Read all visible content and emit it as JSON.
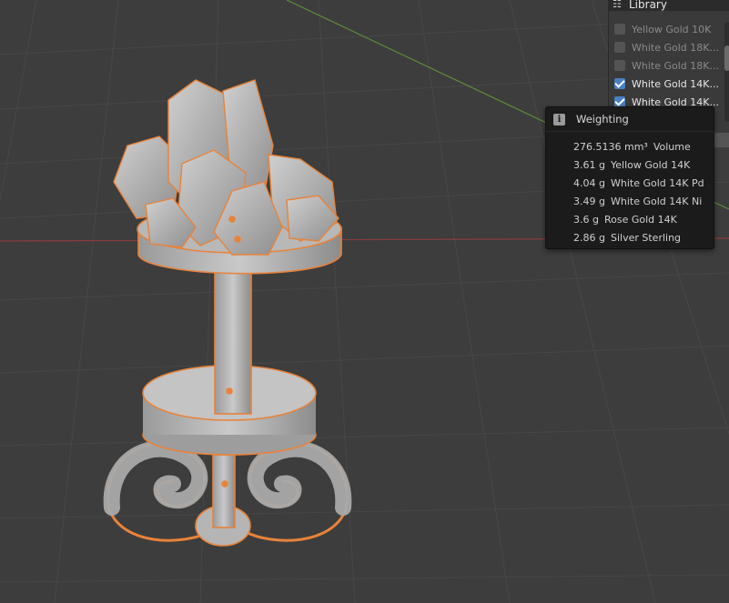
{
  "library": {
    "title": "Library",
    "items": [
      {
        "label": "Yellow Gold 10K",
        "checked": false
      },
      {
        "label": "White Gold 18K...",
        "checked": false
      },
      {
        "label": "White Gold 18K...",
        "checked": false
      },
      {
        "label": "White Gold 14K...",
        "checked": true
      },
      {
        "label": "White Gold 14K...",
        "checked": true
      }
    ]
  },
  "weighting": {
    "title": "Weighting",
    "rows": [
      {
        "value": "276.5136 mm³",
        "label": "Volume"
      },
      {
        "value": "3.61 g",
        "label": "Yellow Gold 14K"
      },
      {
        "value": "4.04 g",
        "label": "White Gold 14K Pd"
      },
      {
        "value": "3.49 g",
        "label": "White Gold 14K Ni"
      },
      {
        "value": "3.6 g",
        "label": "Rose Gold 14K"
      },
      {
        "value": "2.86 g",
        "label": "Silver Sterling"
      }
    ]
  },
  "colors": {
    "viewport_bg": "#3d3d3d",
    "selection_outline": "#e8833a",
    "x_axis": "#8a3c3c",
    "y_axis": "#5f8a3a",
    "accent": "#4a7fc1"
  },
  "icons": {
    "library": "book-icon",
    "info": "info-icon"
  }
}
